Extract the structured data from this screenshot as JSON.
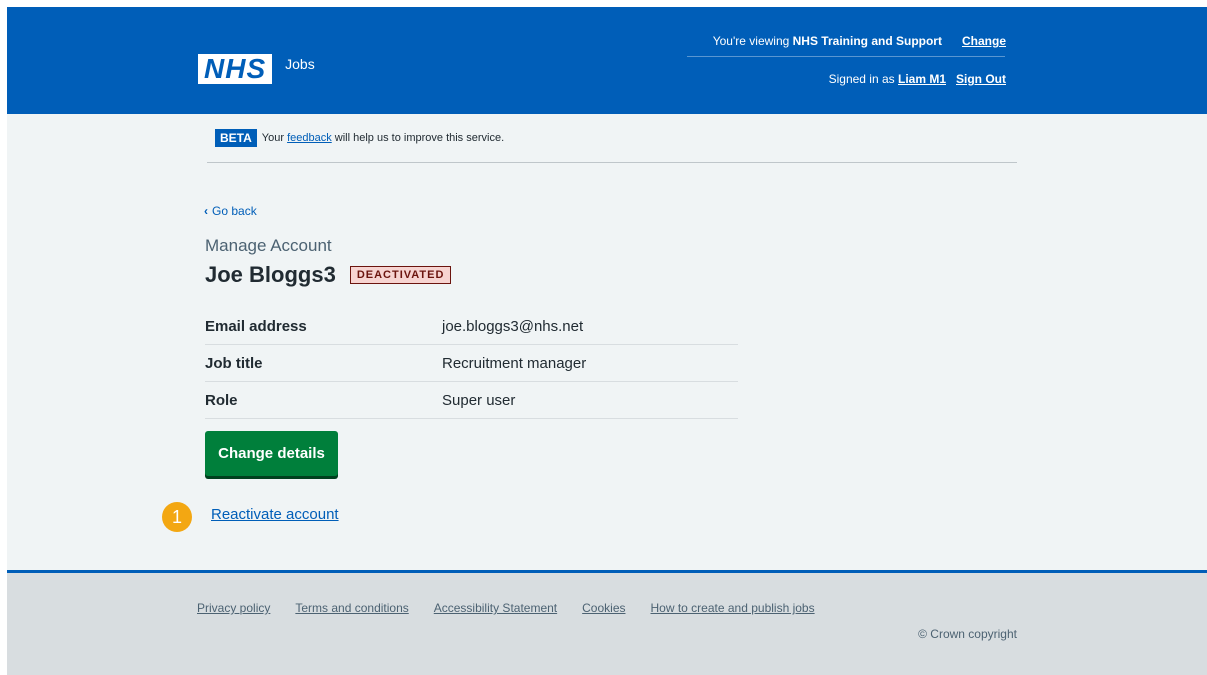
{
  "header": {
    "logo_text": "NHS",
    "service_name": "Jobs",
    "viewing_prefix": "You're viewing ",
    "viewing_org": "NHS Training and Support",
    "change_label": "Change",
    "signed_in_prefix": "Signed in as ",
    "user_name": "Liam M1",
    "sign_out_label": "Sign Out"
  },
  "beta_banner": {
    "tag": "BETA",
    "text_before": "Your ",
    "link": "feedback",
    "text_after": " will help us to improve this service."
  },
  "back_link": "Go back",
  "caption": "Manage Account",
  "title": "Joe Bloggs3",
  "status_tag": "DEACTIVATED",
  "summary": [
    {
      "key": "Email address",
      "value": "joe.bloggs3@nhs.net"
    },
    {
      "key": "Job title",
      "value": "Recruitment manager"
    },
    {
      "key": "Role",
      "value": "Super user"
    }
  ],
  "change_details_label": "Change details",
  "step_number": "1",
  "reactivate_label": "Reactivate account",
  "footer": {
    "links": [
      "Privacy policy",
      "Terms and conditions",
      "Accessibility Statement",
      "Cookies",
      "How to create and publish jobs"
    ],
    "copyright": "© Crown copyright"
  },
  "colors": {
    "header_blue": "#005eb8",
    "button_green": "#007f3b",
    "badge_orange": "#f3a712",
    "deactivated_bg": "#f7d4d1"
  }
}
